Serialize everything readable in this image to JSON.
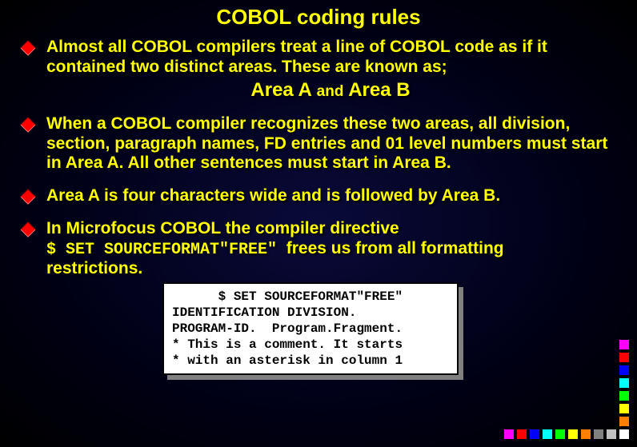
{
  "title": "COBOL coding rules",
  "bullets": {
    "b1": {
      "text": "Almost all COBOL compilers treat a  line of COBOL code as if it contained two distinct areas. These are known as;",
      "areaA": "Area A",
      "and": "and",
      "areaB": "Area B"
    },
    "b2": "When a COBOL compiler recognizes these two areas, all division, section, paragraph names,  FD entries and 01 level numbers must start in Area A.  All other sentences must start in Area B.",
    "b3": "Area A is four characters wide and is followed by Area B.",
    "b4": {
      "line1": "In Microfocus COBOL the compiler directive",
      "code": "$ SET SOURCEFORMAT\"FREE\"",
      "line2a": "frees us from all formatting",
      "line2b": "restrictions."
    }
  },
  "codebox": {
    "l1": "      $ SET SOURCEFORMAT\"FREE\"",
    "l2": "IDENTIFICATION DIVISION.",
    "l3": "PROGRAM-ID.  Program.Fragment.",
    "l4": "* This is a comment. It starts",
    "l5": "* with an asterisk in column 1"
  },
  "colors": {
    "vsq": [
      "#ff00ff",
      "#ff0000",
      "#0000ff",
      "#00ffff",
      "#00ff00",
      "#ffff00",
      "#ff8000"
    ],
    "hsq": [
      "#ff00ff",
      "#ff0000",
      "#0000ff",
      "#00ffff",
      "#00ff00",
      "#ffff00",
      "#ff8000",
      "#808080",
      "#c0c0c0",
      "#ffffff"
    ]
  }
}
